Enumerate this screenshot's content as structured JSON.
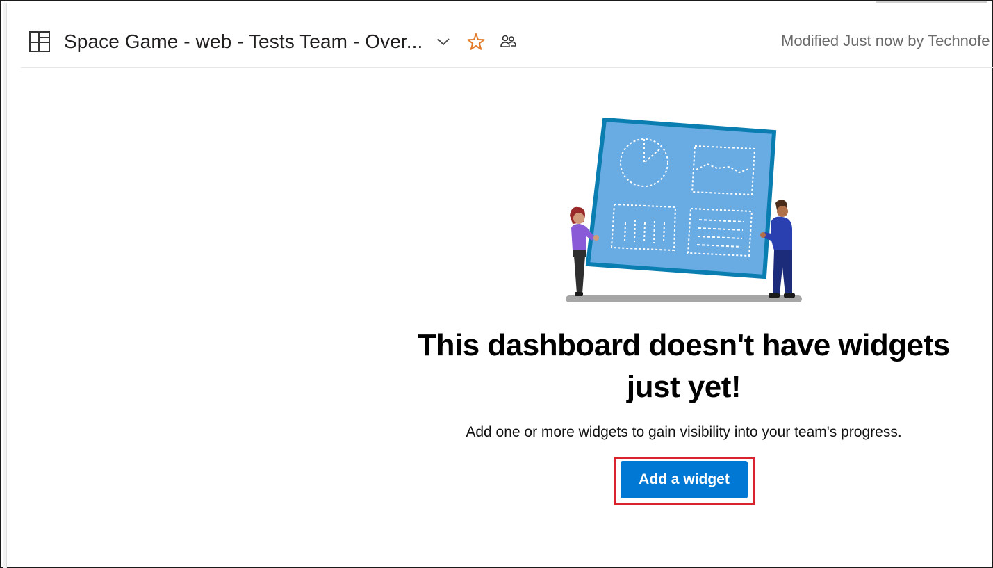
{
  "header": {
    "title": "Space Game - web - Tests Team - Over...",
    "modified": "Modified Just now by Technofe",
    "icons": [
      "dashboard-icon",
      "chevron-down-icon",
      "favorite-star-icon",
      "team-members-icon"
    ]
  },
  "empty_state": {
    "illustration": "people-holding-dashboard-board",
    "headline": "This dashboard doesn't have widgets just yet!",
    "description": "Add one or more widgets to gain visibility into your team's progress.",
    "button_label": "Add a widget"
  },
  "colors": {
    "accent": "#0078d4",
    "star": "#e07a2a",
    "highlight": "#d9232e",
    "board_fill": "#69abe3",
    "board_border": "#0a7eb0"
  }
}
